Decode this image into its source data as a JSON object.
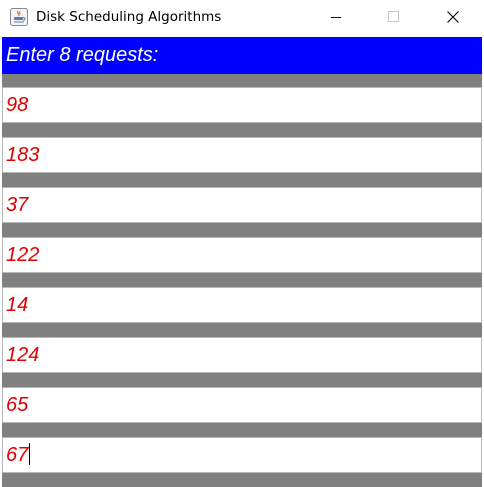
{
  "window": {
    "title": "Disk Scheduling Algorithms",
    "controls": {
      "minimize_icon": "minimize-icon",
      "maximize_icon": "maximize-icon",
      "close_icon": "close-icon"
    }
  },
  "form": {
    "prompt": "Enter 8 requests:",
    "requests": [
      "98",
      "183",
      "37",
      "122",
      "14",
      "124",
      "65",
      "67"
    ],
    "focused_field_index": 7
  },
  "colors": {
    "header_background": "#0000ff",
    "header_text": "#ffffff",
    "input_text": "#e00000",
    "separator": "#808080"
  }
}
